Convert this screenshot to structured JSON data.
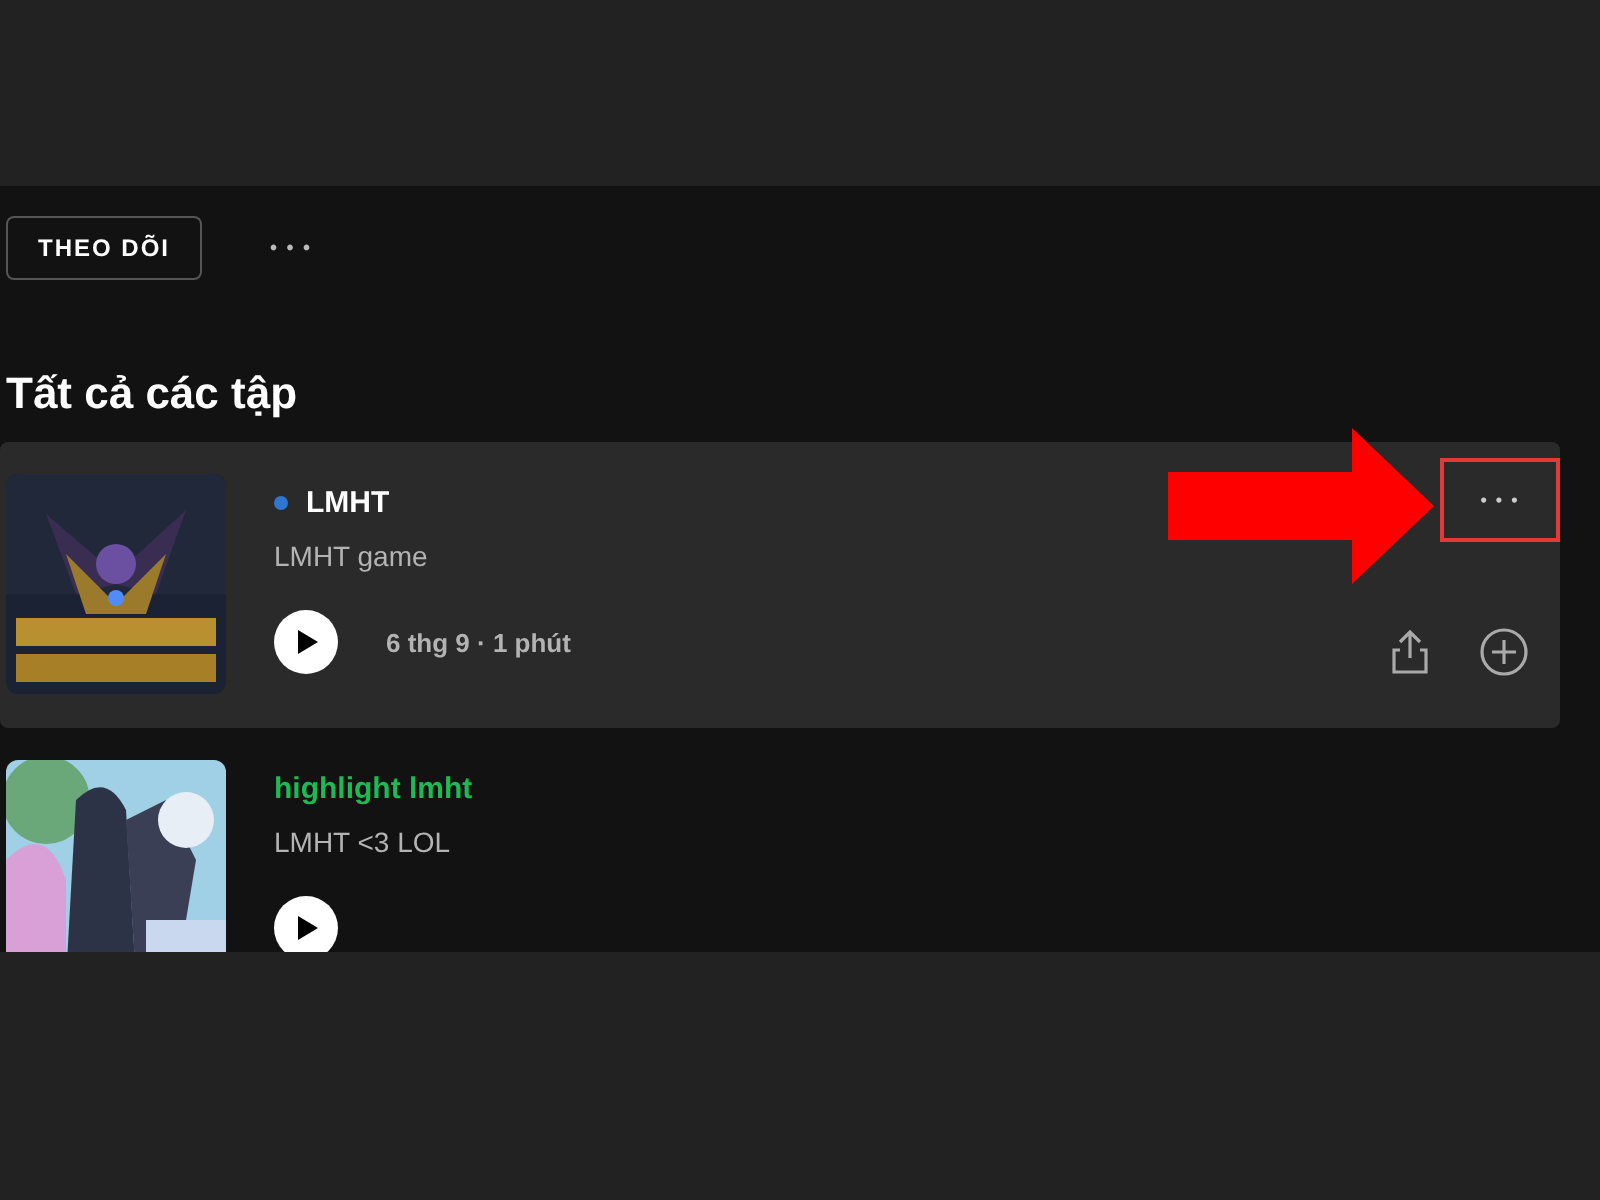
{
  "follow_button": {
    "label": "THEO DÕI"
  },
  "more_options": {
    "label": "• • •"
  },
  "heading": "Tất cả các tập",
  "episodes": [
    {
      "title": "LMHT",
      "played": false,
      "description": "LMHT game",
      "meta": "6 thg 9 · 1 phút",
      "hovered": true,
      "more_highlighted": true,
      "more_label": "• • •"
    },
    {
      "title": "highlight lmht",
      "played": true,
      "description": "LMHT <3 LOL",
      "hovered": false
    }
  ]
}
